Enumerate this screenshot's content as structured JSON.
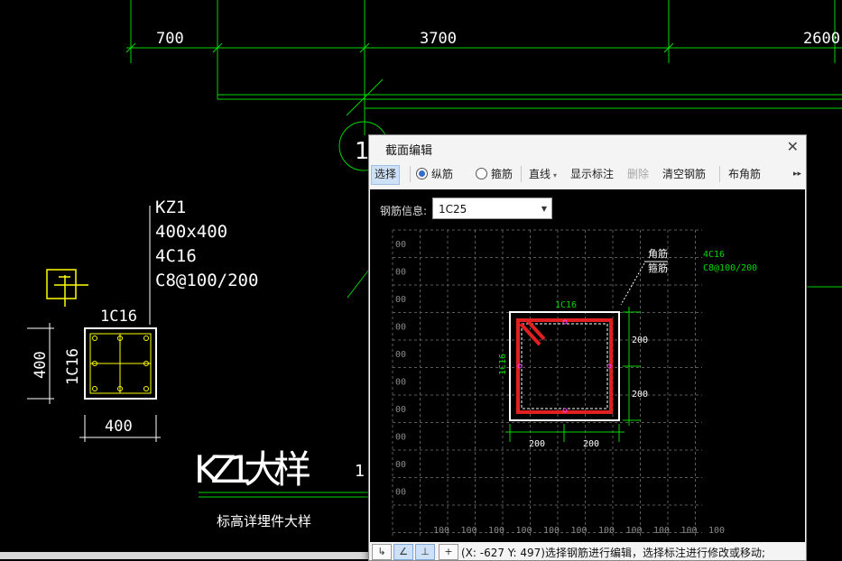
{
  "drawing": {
    "dims_top": [
      "700",
      "3700",
      "2600"
    ],
    "column": {
      "name": "KZ1",
      "size": "400x400",
      "main_rebar": "4C16",
      "stirrup": "C8@100/200",
      "side_top_label": "1C16",
      "side_left_label": "1C16",
      "dim_bottom": "400",
      "dim_left": "400"
    },
    "big_title": "KZ1大样",
    "sub_title": "标高详埋件大样",
    "fragment_label_1": "1",
    "fragment_label_2": "1"
  },
  "dialog": {
    "title": "截面编辑",
    "close_glyph": "✕",
    "toolbar": {
      "select": "选择",
      "longitudinal": "纵筋",
      "stirrup": "箍筋",
      "line": "直线",
      "show_dim": "显示标注",
      "delete": "删除",
      "clear": "清空钢筋",
      "corner": "布角筋",
      "more": "▸▸"
    },
    "rebar_info_label": "钢筋信息:",
    "rebar_info_value": "1C25",
    "canvas": {
      "axis_label": "00",
      "grid_bottom_label": "100",
      "callout_corner": "角筋",
      "callout_stirrup": "箍筋",
      "main_rebar": "4C16",
      "stirrup_spec": "C8@100/200",
      "top_label": "1C16",
      "left_label": "1C16",
      "dim_right_1": "200",
      "dim_right_2": "200",
      "dim_bottom_1": "200",
      "dim_bottom_2": "200"
    },
    "status": {
      "text": "(X: -627 Y: 497)选择钢筋进行编辑，选择标注进行修改或移动;",
      "btn_1": "↳",
      "btn_2": "∠",
      "btn_3": "⊥",
      "btn_4": "+"
    }
  },
  "colors": {
    "cad_green": "#00d800",
    "cad_white": "#ffffff",
    "cad_yellow": "#ffff00",
    "rebar_red": "#e02020",
    "grid_gray": "#5a5a5a"
  }
}
